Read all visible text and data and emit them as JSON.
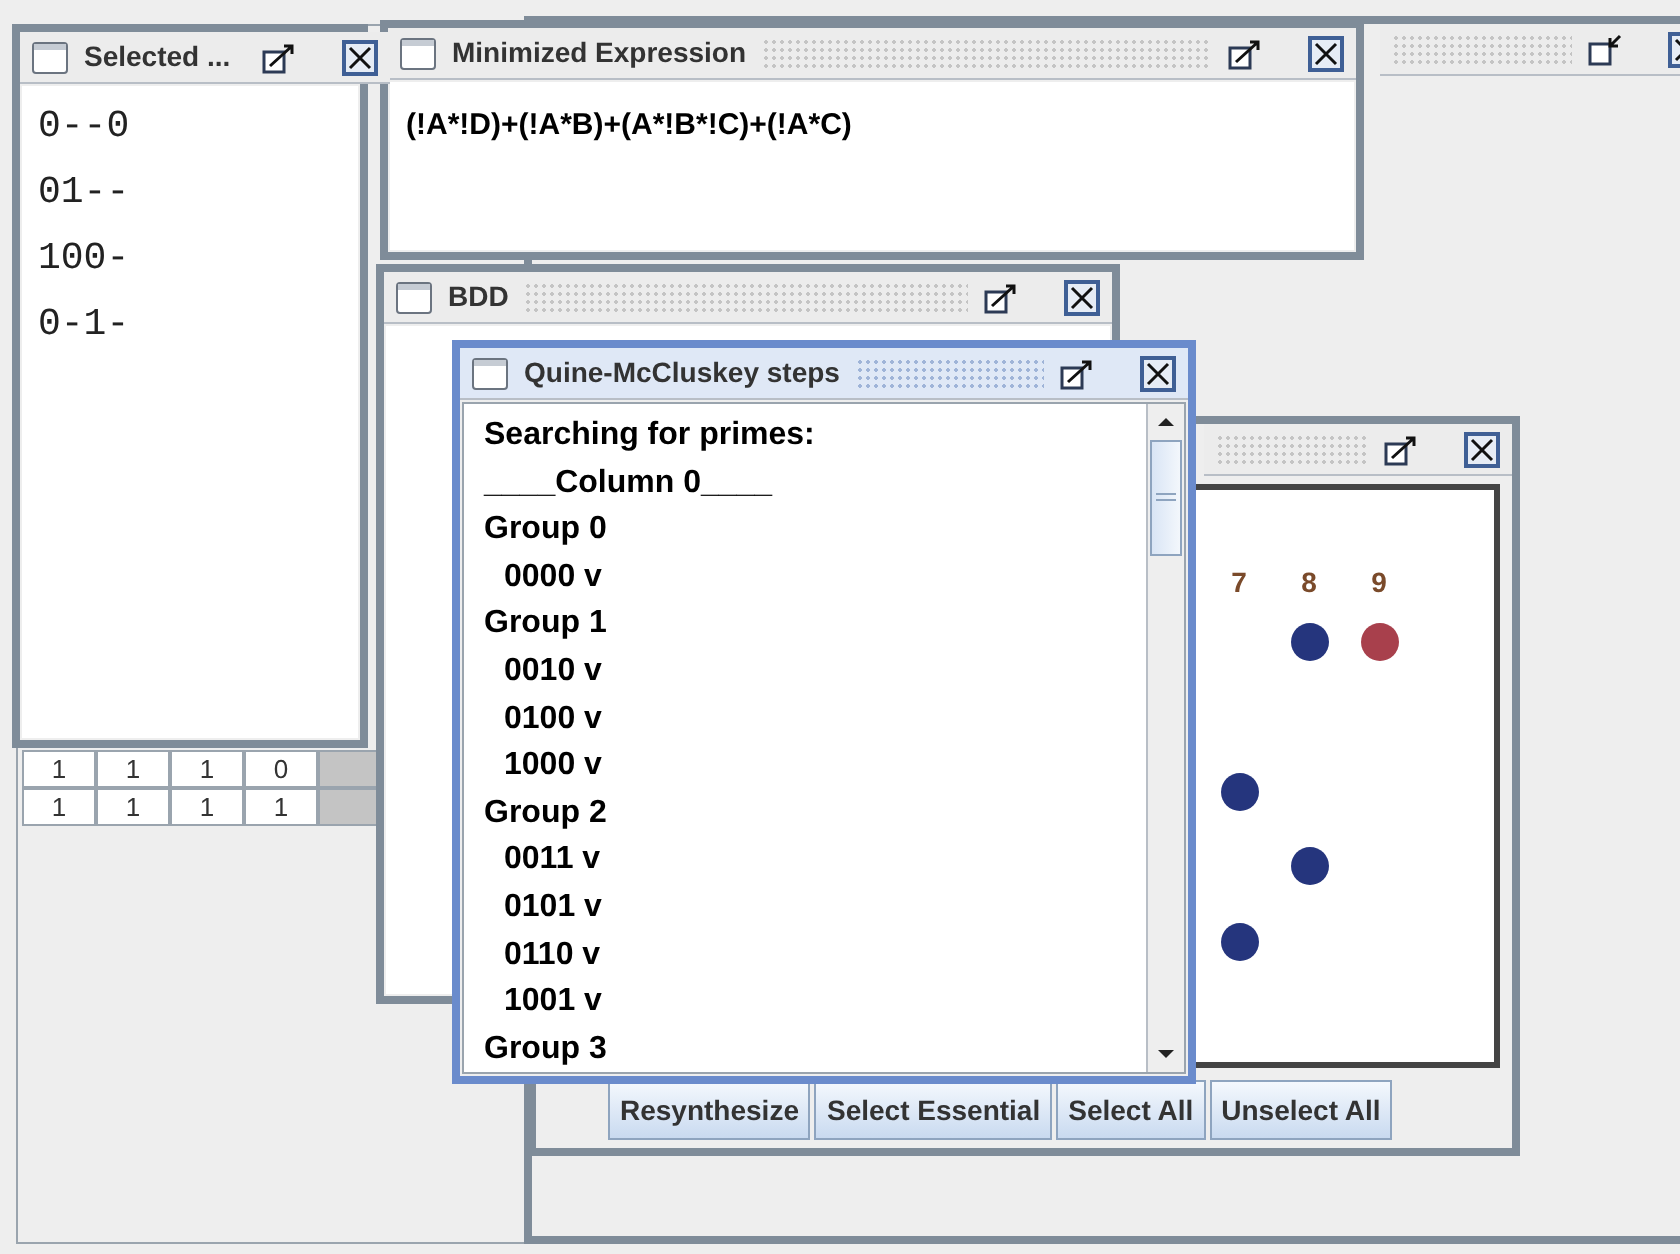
{
  "left_panel": {
    "table": {
      "rows": [
        [
          "1",
          "1",
          "1",
          "0"
        ],
        [
          "1",
          "1",
          "1",
          "1"
        ]
      ]
    }
  },
  "desktop_frame": {
    "active": false
  },
  "coverage_window": {
    "active": false,
    "columns": [
      "7",
      "8",
      "9"
    ],
    "rows": [
      {
        "cells": [
          {
            "kind": "empty"
          },
          {
            "kind": "dot",
            "color": "#25357d"
          },
          {
            "kind": "dot",
            "color": "#a8404c"
          }
        ]
      },
      {
        "cells": [
          {
            "kind": "empty"
          },
          {
            "kind": "empty"
          },
          {
            "kind": "empty"
          }
        ]
      },
      {
        "cells": [
          {
            "kind": "dot",
            "color": "#25357d"
          },
          {
            "kind": "empty"
          },
          {
            "kind": "empty"
          }
        ]
      },
      {
        "cells": [
          {
            "kind": "empty"
          },
          {
            "kind": "dot",
            "color": "#25357d"
          },
          {
            "kind": "empty"
          }
        ]
      },
      {
        "cells": [
          {
            "kind": "dot",
            "color": "#25357d"
          },
          {
            "kind": "empty"
          },
          {
            "kind": "empty"
          }
        ]
      }
    ],
    "buttons": [
      "Resynthesize",
      "Select Essential",
      "Select All",
      "Unselect All"
    ]
  },
  "expression_window": {
    "title": "Minimized Expression",
    "active": false,
    "expression": "(!A*!D)+(!A*B)+(A*!B*!C)+(!A*C)"
  },
  "selected_window": {
    "title": "Selected ...",
    "active": false,
    "lines": [
      "0--0",
      "01--",
      "100-",
      "0-1-"
    ]
  },
  "bdd_window": {
    "title": "BDD",
    "active": false
  },
  "qm_window": {
    "title": "Quine-McCluskey steps",
    "active": true,
    "lines": [
      {
        "kind": "heading",
        "text": "Searching for primes:"
      },
      {
        "kind": "heading",
        "text": "____Column 0____"
      },
      {
        "kind": "heading",
        "text": "Group 0"
      },
      {
        "kind": "item",
        "text": "0000 v"
      },
      {
        "kind": "heading",
        "text": "Group 1"
      },
      {
        "kind": "item",
        "text": "0010 v"
      },
      {
        "kind": "item",
        "text": "0100 v"
      },
      {
        "kind": "item",
        "text": "1000 v"
      },
      {
        "kind": "heading",
        "text": "Group 2"
      },
      {
        "kind": "item",
        "text": "0011 v"
      },
      {
        "kind": "item",
        "text": "0101 v"
      },
      {
        "kind": "item",
        "text": "0110 v"
      },
      {
        "kind": "item",
        "text": "1001 v"
      },
      {
        "kind": "heading",
        "text": "Group 3"
      }
    ]
  }
}
